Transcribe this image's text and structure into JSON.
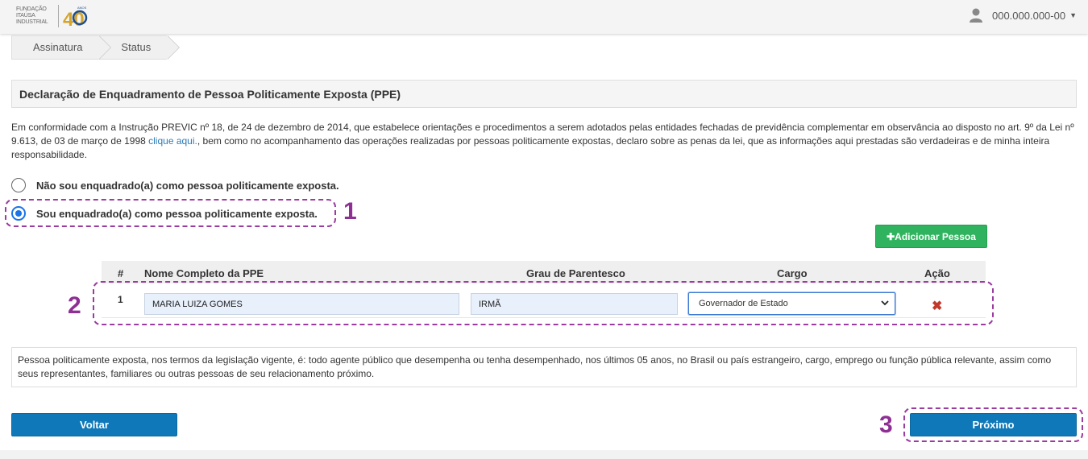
{
  "header": {
    "logo_lines": [
      "FUNDAÇÃO",
      "ITAÚSA",
      "INDUSTRIAL"
    ],
    "logo_anos": "ANOS",
    "logo_number": "40",
    "user_cpf": "000.000.000-00"
  },
  "breadcrumb": [
    "Assinatura",
    "Status"
  ],
  "panel": {
    "title": "Declaração de Enquadramento de Pessoa Politicamente Exposta (PPE)"
  },
  "intro": {
    "text_before_link": "Em conformidade com a Instrução PREVIC nº 18, de 24 de dezembro de 2014, que estabelece orientações e procedimentos a serem adotados pelas entidades fechadas de previdência complementar em observância ao disposto no art. 9º da Lei nº 9.613, de 03 de março de 1998 ",
    "link_text": "clique aqui.",
    "text_after_link": ", bem como no acompanhamento das operações realizadas por pessoas politicamente expostas, declaro sobre as penas da lei, que as informações aqui prestadas são verdadeiras e de minha inteira responsabilidade."
  },
  "options": {
    "not_ppe": "Não sou enquadrado(a) como pessoa politicamente exposta.",
    "is_ppe": "Sou enquadrado(a) como pessoa politicamente exposta.",
    "selected": "is_ppe"
  },
  "add_person_label": "Adicionar Pessoa",
  "table": {
    "headers": {
      "num": "#",
      "name": "Nome Completo da PPE",
      "kinship": "Grau de Parentesco",
      "role": "Cargo",
      "action": "Ação"
    },
    "rows": [
      {
        "num": "1",
        "name": "MARIA LUIZA GOMES",
        "kinship": "IRMÃ",
        "role": "Governador de Estado"
      }
    ]
  },
  "note": "Pessoa politicamente exposta, nos termos da legislação vigente, é: todo agente público que desempenha ou tenha desempenhado, nos últimos 05 anos, no Brasil ou país estrangeiro, cargo, emprego ou função pública relevante, assim como seus representantes, familiares ou outras pessoas de seu relacionamento próximo.",
  "buttons": {
    "back": "Voltar",
    "next": "Próximo"
  },
  "annotations": [
    "1",
    "2",
    "3"
  ],
  "colors": {
    "primary": "#0f78b8",
    "success": "#2fb35e",
    "annotation": "#9b3ba0",
    "danger": "#c0392b",
    "link": "#2a7ab8"
  }
}
